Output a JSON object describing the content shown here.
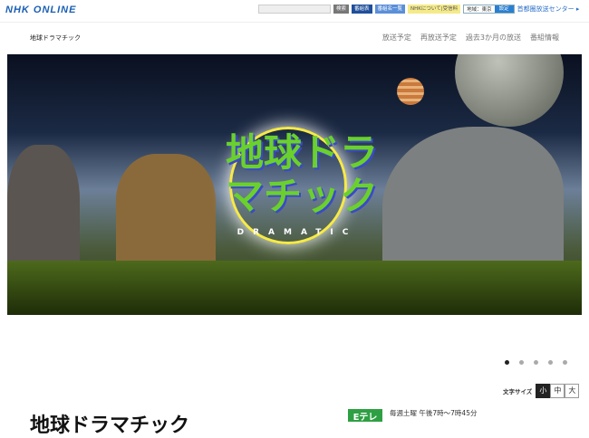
{
  "header": {
    "logo": "NHK ONLINE",
    "search_button": "検索",
    "schedule_button": "番組表",
    "program_list_button": "番組名一覧",
    "about_button": "NHKについて|受信料",
    "region_label": "地域：東京",
    "region_set_button": "設定",
    "broadcast_center_link": "首都圏放送センター"
  },
  "program_header": {
    "title": "地球ドラマチック",
    "nav": [
      "放送予定",
      "再放送予定",
      "過去3か月の放送",
      "番組情報"
    ]
  },
  "hero": {
    "title": "地球ドラマチック",
    "subtitle": "DRAMATIC",
    "slides": 5,
    "active_slide": 1
  },
  "font_size": {
    "label": "文字サイズ",
    "options": [
      "小",
      "中",
      "大"
    ],
    "selected": "小"
  },
  "main": {
    "title": "地球ドラマチック",
    "channel": "Eテレ",
    "schedule": "毎週土曜 午後7時～7時45分"
  }
}
